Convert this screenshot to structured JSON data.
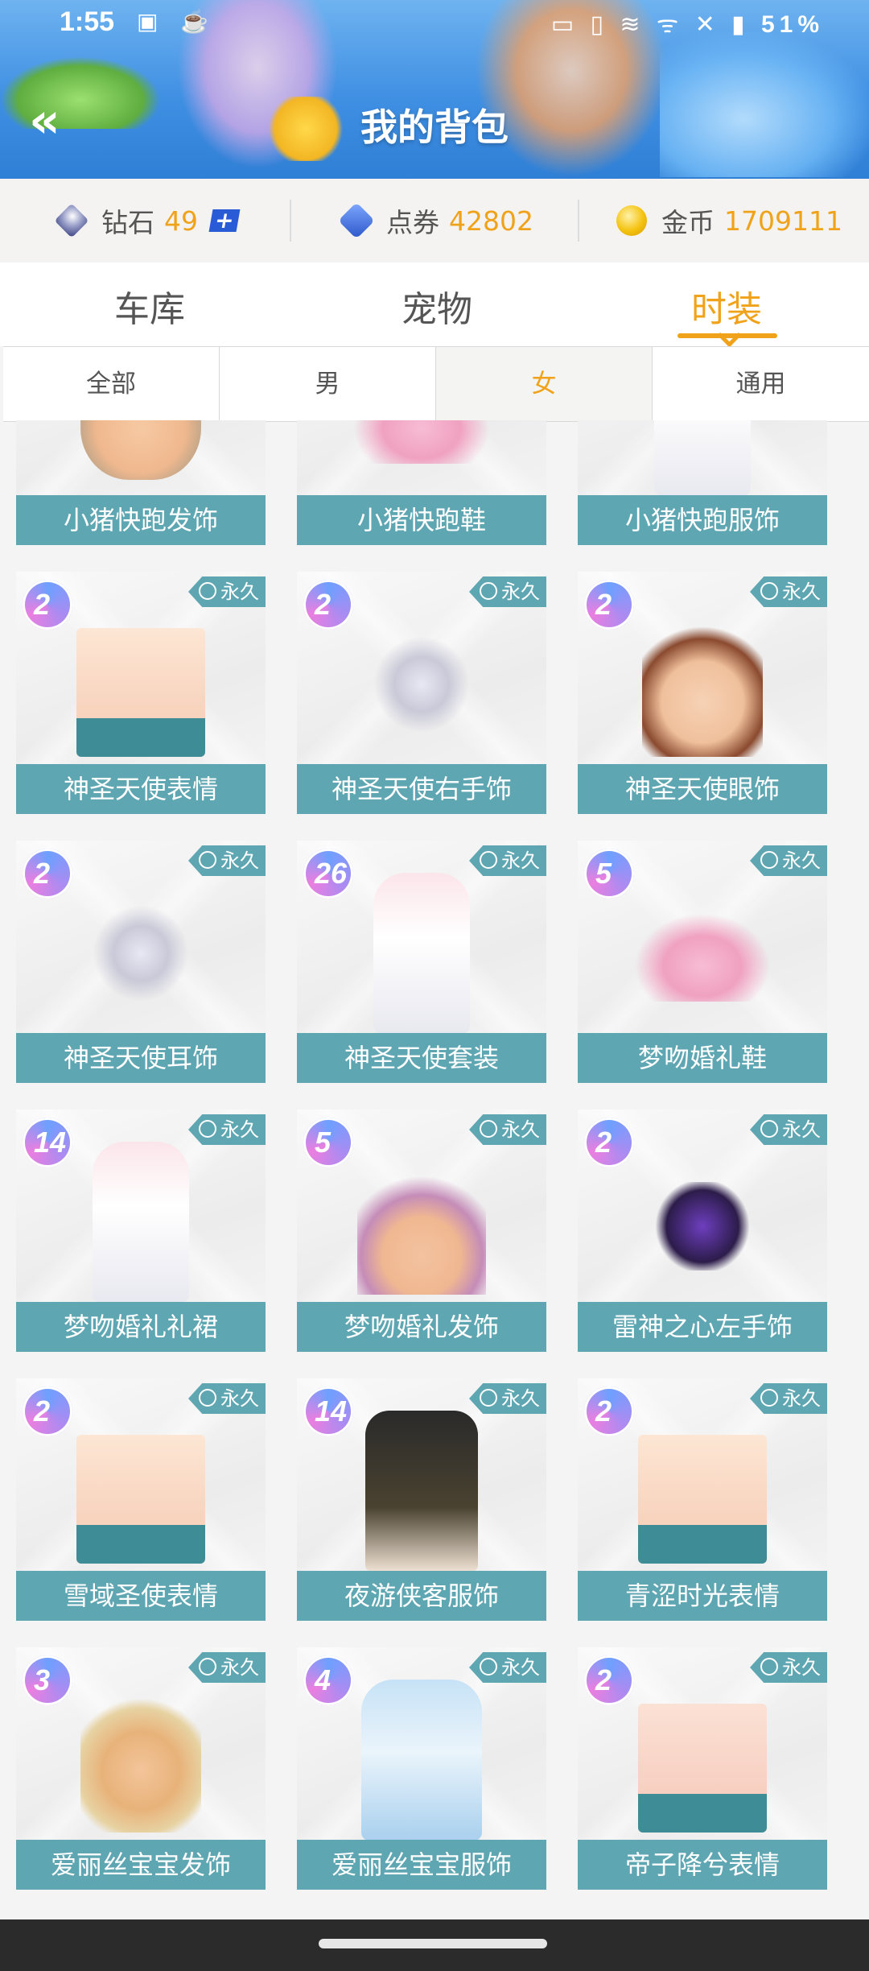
{
  "status_bar": {
    "time": "1:55",
    "left_icons": "▣ ☕",
    "right_icons": "▭ ▯ ≋ ᯤ ✕ ▮",
    "battery": "51%"
  },
  "header": {
    "title": "我的背包",
    "back_label": "«"
  },
  "currency": {
    "diamond": {
      "label": "钻石",
      "value": "49",
      "icon": "diamond-icon"
    },
    "voucher": {
      "label": "点券",
      "value": "42802",
      "icon": "voucher-icon"
    },
    "gold": {
      "label": "金币",
      "value": "1709111",
      "icon": "coin-icon"
    },
    "plus": "+"
  },
  "tabs": [
    {
      "label": "车库"
    },
    {
      "label": "宠物"
    },
    {
      "label": "时装"
    }
  ],
  "subtabs": [
    {
      "label": "全部"
    },
    {
      "label": "男"
    },
    {
      "label": "女"
    },
    {
      "label": "通用"
    }
  ],
  "colors": {
    "accent": "#f0a31a",
    "label_bg": "#5fa6b3",
    "header_bg": "#3f8fe3",
    "navbar": "#2b2b2b"
  },
  "items": [
    {
      "name": "小猪快跑发饰",
      "art": "head",
      "level": "",
      "badge": ""
    },
    {
      "name": "小猪快跑鞋",
      "art": "shoe",
      "level": "",
      "badge": ""
    },
    {
      "name": "小猪快跑服饰",
      "art": "outfit",
      "level": "",
      "badge": ""
    },
    {
      "name": "神圣天使表情",
      "art": "face",
      "level": "2",
      "badge": "永久"
    },
    {
      "name": "神圣天使右手饰",
      "art": "acc",
      "level": "2",
      "badge": "永久"
    },
    {
      "name": "神圣天使眼饰",
      "art": "brown",
      "level": "2",
      "badge": "永久"
    },
    {
      "name": "神圣天使耳饰",
      "art": "acc",
      "level": "2",
      "badge": "永久"
    },
    {
      "name": "神圣天使套装",
      "art": "outfit",
      "level": "26",
      "badge": "永久"
    },
    {
      "name": "梦吻婚礼鞋",
      "art": "shoe",
      "level": "5",
      "badge": "永久"
    },
    {
      "name": "梦吻婚礼礼裙",
      "art": "outfit",
      "level": "14",
      "badge": "永久"
    },
    {
      "name": "梦吻婚礼发饰",
      "art": "tiara",
      "level": "5",
      "badge": "永久"
    },
    {
      "name": "雷神之心左手饰",
      "art": "purple",
      "level": "2",
      "badge": "永久"
    },
    {
      "name": "雪域圣使表情",
      "art": "face",
      "level": "2",
      "badge": "永久"
    },
    {
      "name": "夜游侠客服饰",
      "art": "dark",
      "level": "14",
      "badge": "永久"
    },
    {
      "name": "青涩时光表情",
      "art": "face",
      "level": "2",
      "badge": "永久"
    },
    {
      "name": "爱丽丝宝宝发饰",
      "art": "blonde",
      "level": "3",
      "badge": "永久"
    },
    {
      "name": "爱丽丝宝宝服饰",
      "art": "blue",
      "level": "4",
      "badge": "永久"
    },
    {
      "name": "帝子降兮表情",
      "art": "red",
      "level": "2",
      "badge": "永久"
    }
  ]
}
